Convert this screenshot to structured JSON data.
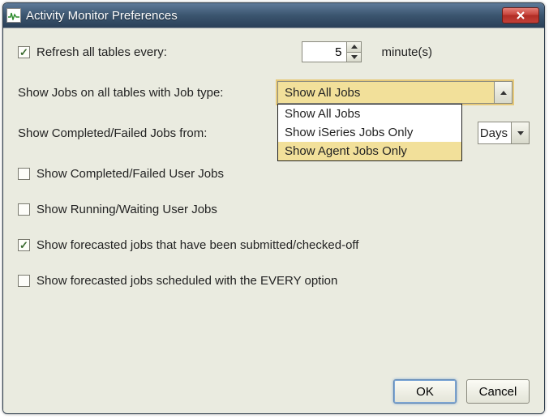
{
  "window": {
    "title": "Activity Monitor Preferences"
  },
  "refresh": {
    "label": "Refresh all tables every:",
    "value": "5",
    "unit": "minute(s)",
    "checked": true
  },
  "jobtype": {
    "label": "Show Jobs on all tables with Job type:",
    "selected": "Show All Jobs",
    "options": [
      "Show All Jobs",
      "Show iSeries Jobs Only",
      "Show Agent Jobs Only"
    ],
    "highlight_index": 2
  },
  "fromrange": {
    "label": "Show Completed/Failed Jobs from:",
    "visible_text": " Days"
  },
  "checks": [
    {
      "label": "Show Completed/Failed User Jobs",
      "checked": false
    },
    {
      "label": "Show Running/Waiting User Jobs",
      "checked": false
    },
    {
      "label": "Show forecasted jobs that have been submitted/checked-off",
      "checked": true
    },
    {
      "label": "Show forecasted jobs scheduled with the EVERY option",
      "checked": false
    }
  ],
  "buttons": {
    "ok": "OK",
    "cancel": "Cancel"
  }
}
